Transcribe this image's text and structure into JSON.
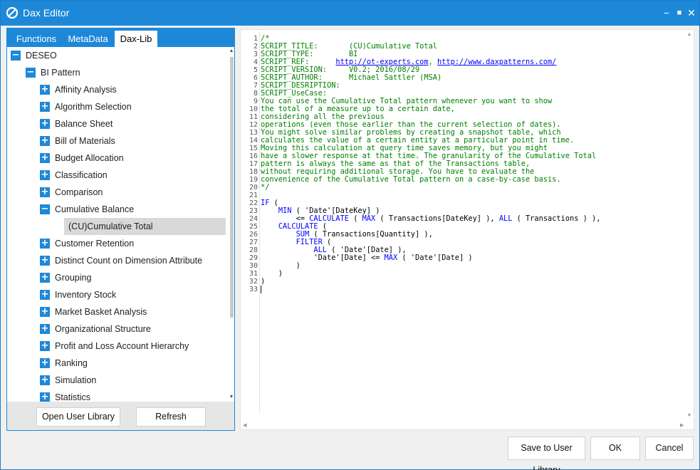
{
  "window": {
    "title": "Dax Editor",
    "minimize": "−",
    "maximize": "■",
    "close": "✕",
    "accent": "#1e88d8"
  },
  "tabs": [
    "Functions",
    "MetaData",
    "Dax-Lib"
  ],
  "tree": {
    "root": {
      "label": "DESEO",
      "state": "expanded"
    },
    "group": {
      "label": "BI Pattern",
      "state": "expanded"
    },
    "items": [
      {
        "label": "Affinity Analysis",
        "state": "collapsed"
      },
      {
        "label": "Algorithm Selection",
        "state": "collapsed"
      },
      {
        "label": "Balance Sheet",
        "state": "collapsed"
      },
      {
        "label": "Bill of Materials",
        "state": "collapsed"
      },
      {
        "label": "Budget Allocation",
        "state": "collapsed"
      },
      {
        "label": "Classification",
        "state": "collapsed"
      },
      {
        "label": "Comparison",
        "state": "collapsed"
      },
      {
        "label": "Cumulative Balance",
        "state": "expanded"
      },
      {
        "label": "(CU)Cumulative Total",
        "state": "leaf-selected"
      },
      {
        "label": "Customer Retention",
        "state": "collapsed"
      },
      {
        "label": "Distinct Count on Dimension Attribute",
        "state": "collapsed"
      },
      {
        "label": "Grouping",
        "state": "collapsed"
      },
      {
        "label": "Inventory Stock",
        "state": "collapsed"
      },
      {
        "label": "Market Basket Analysis",
        "state": "collapsed"
      },
      {
        "label": "Organizational Structure",
        "state": "collapsed"
      },
      {
        "label": "Profit and Loss Account Hierarchy",
        "state": "collapsed"
      },
      {
        "label": "Ranking",
        "state": "collapsed"
      },
      {
        "label": "Simulation",
        "state": "collapsed"
      },
      {
        "label": "Statistics",
        "state": "collapsed"
      }
    ],
    "plus": "+",
    "minus": "−"
  },
  "left_buttons": {
    "open": "Open User Library",
    "refresh": "Refresh"
  },
  "editor": {
    "lines": [
      [
        {
          "t": "/*",
          "c": "cm"
        }
      ],
      [
        {
          "t": "SCRIPT_TITLE:       (CU)Cumulative Total",
          "c": "cm"
        }
      ],
      [
        {
          "t": "SCRIPT_TYPE:        BI",
          "c": "cm"
        }
      ],
      [
        {
          "t": "SCRIPT_REF:      ",
          "c": "cm"
        },
        {
          "t": "http://ot-experts.com",
          "c": "ln"
        },
        {
          "t": ", ",
          "c": "cm"
        },
        {
          "t": "http://www.daxpatterns.com/",
          "c": "ln"
        }
      ],
      [
        {
          "t": "SCRIPT_VERSION:     V0.2; 2016/08/29",
          "c": "cm"
        }
      ],
      [
        {
          "t": "SCRIPT_AUTHOR:      Michael Sattler (MSA)",
          "c": "cm"
        }
      ],
      [
        {
          "t": "SCRIPT_DESRIPTION:",
          "c": "cm"
        }
      ],
      [
        {
          "t": "SCRIPT_UseCase:",
          "c": "cm"
        }
      ],
      [
        {
          "t": "You can use the Cumulative Total pattern whenever you want to show",
          "c": "cm"
        }
      ],
      [
        {
          "t": "the total of a measure up to a certain date,",
          "c": "cm"
        }
      ],
      [
        {
          "t": "considering all the previous",
          "c": "cm"
        }
      ],
      [
        {
          "t": "operations (even those earlier than the current selection of dates).",
          "c": "cm"
        }
      ],
      [
        {
          "t": "You might solve similar problems by creating a snapshot table, which",
          "c": "cm"
        }
      ],
      [
        {
          "t": "calculates the value of a certain entity at a particular point in time.",
          "c": "cm"
        }
      ],
      [
        {
          "t": "Moving this calculation at query time saves memory, but you might",
          "c": "cm"
        }
      ],
      [
        {
          "t": "have a slower response at that time. The granularity of the Cumulative Total",
          "c": "cm"
        }
      ],
      [
        {
          "t": "pattern is always the same as that of the Transactions table,",
          "c": "cm"
        }
      ],
      [
        {
          "t": "without requiring additional storage. You have to evaluate the",
          "c": "cm"
        }
      ],
      [
        {
          "t": "convenience of the Cumulative Total pattern on a case-by-case basis.",
          "c": "cm"
        }
      ],
      [
        {
          "t": "*/",
          "c": "cm"
        }
      ],
      [
        {
          "t": "",
          "c": ""
        }
      ],
      [
        {
          "t": "IF",
          "c": "kw"
        },
        {
          "t": " (",
          "c": ""
        }
      ],
      [
        {
          "t": "    ",
          "c": ""
        },
        {
          "t": "MIN",
          "c": "kw"
        },
        {
          "t": " ( 'Date'[DateKey] )",
          "c": ""
        }
      ],
      [
        {
          "t": "        <= ",
          "c": ""
        },
        {
          "t": "CALCULATE",
          "c": "kw"
        },
        {
          "t": " ( ",
          "c": ""
        },
        {
          "t": "MAX",
          "c": "kw"
        },
        {
          "t": " ( Transactions[DateKey] ), ",
          "c": ""
        },
        {
          "t": "ALL",
          "c": "kw"
        },
        {
          "t": " ( Transactions ) ),",
          "c": ""
        }
      ],
      [
        {
          "t": "    ",
          "c": ""
        },
        {
          "t": "CALCULATE",
          "c": "kw"
        },
        {
          "t": " (",
          "c": ""
        }
      ],
      [
        {
          "t": "        ",
          "c": ""
        },
        {
          "t": "SUM",
          "c": "kw"
        },
        {
          "t": " ( Transactions[Quantity] ),",
          "c": ""
        }
      ],
      [
        {
          "t": "        ",
          "c": ""
        },
        {
          "t": "FILTER",
          "c": "kw"
        },
        {
          "t": " (",
          "c": ""
        }
      ],
      [
        {
          "t": "            ",
          "c": ""
        },
        {
          "t": "ALL",
          "c": "kw"
        },
        {
          "t": " ( 'Date'[Date] ),",
          "c": ""
        }
      ],
      [
        {
          "t": "            'Date'[Date] <= ",
          "c": ""
        },
        {
          "t": "MAX",
          "c": "kw"
        },
        {
          "t": " ( 'Date'[Date] )",
          "c": ""
        }
      ],
      [
        {
          "t": "        )",
          "c": ""
        }
      ],
      [
        {
          "t": "    )",
          "c": ""
        }
      ],
      [
        {
          "t": ")",
          "c": ""
        }
      ],
      [
        {
          "t": "",
          "c": ""
        }
      ]
    ]
  },
  "bottom_buttons": {
    "save": "Save to User Library",
    "ok": "OK",
    "cancel": "Cancel"
  },
  "scroll_arrows": {
    "up": "▲",
    "down": "▼",
    "left": "◀",
    "right": "▶"
  }
}
